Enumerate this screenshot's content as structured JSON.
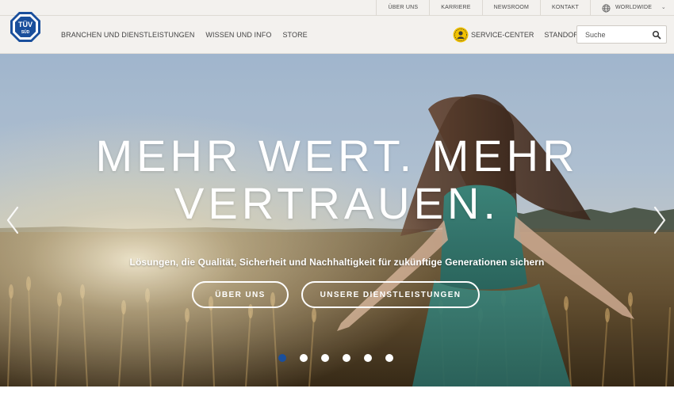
{
  "brand": {
    "logo_text_top": "TÜV",
    "logo_text_bottom": "SÜD",
    "logo_color": "#1a4f9c"
  },
  "utility_nav": {
    "items": [
      {
        "label": "ÜBER UNS"
      },
      {
        "label": "KARRIERE"
      },
      {
        "label": "NEWSROOM"
      },
      {
        "label": "KONTAKT"
      }
    ],
    "worldwide": {
      "label": "WORLDWIDE",
      "icon": "globe-icon",
      "chevron": "chevron-down-icon"
    }
  },
  "main_nav": {
    "items": [
      {
        "label": "BRANCHEN UND DIENSTLEISTUNGEN"
      },
      {
        "label": "WISSEN UND INFO"
      },
      {
        "label": "STORE"
      }
    ],
    "service_center": {
      "label": "SERVICE-CENTER",
      "icon": "service-center-icon"
    },
    "standorte": {
      "label": "STANDORTE"
    }
  },
  "search": {
    "placeholder": "Suche",
    "icon": "search-icon"
  },
  "hero": {
    "headline_line1": "MEHR WERT. MEHR",
    "headline_line2": "VERTRAUEN.",
    "subtitle": "Lösungen, die Qualität, Sicherheit und Nachhaltigkeit für zukünftige Generationen sichern",
    "button_about": "ÜBER UNS",
    "button_services": "UNSERE DIENSTLEISTUNGEN",
    "slide_count": 6,
    "active_slide": 1
  },
  "colors": {
    "accent": "#1a4f9c",
    "header_bg": "#f3f1ee",
    "service_icon": "#f2c200"
  }
}
